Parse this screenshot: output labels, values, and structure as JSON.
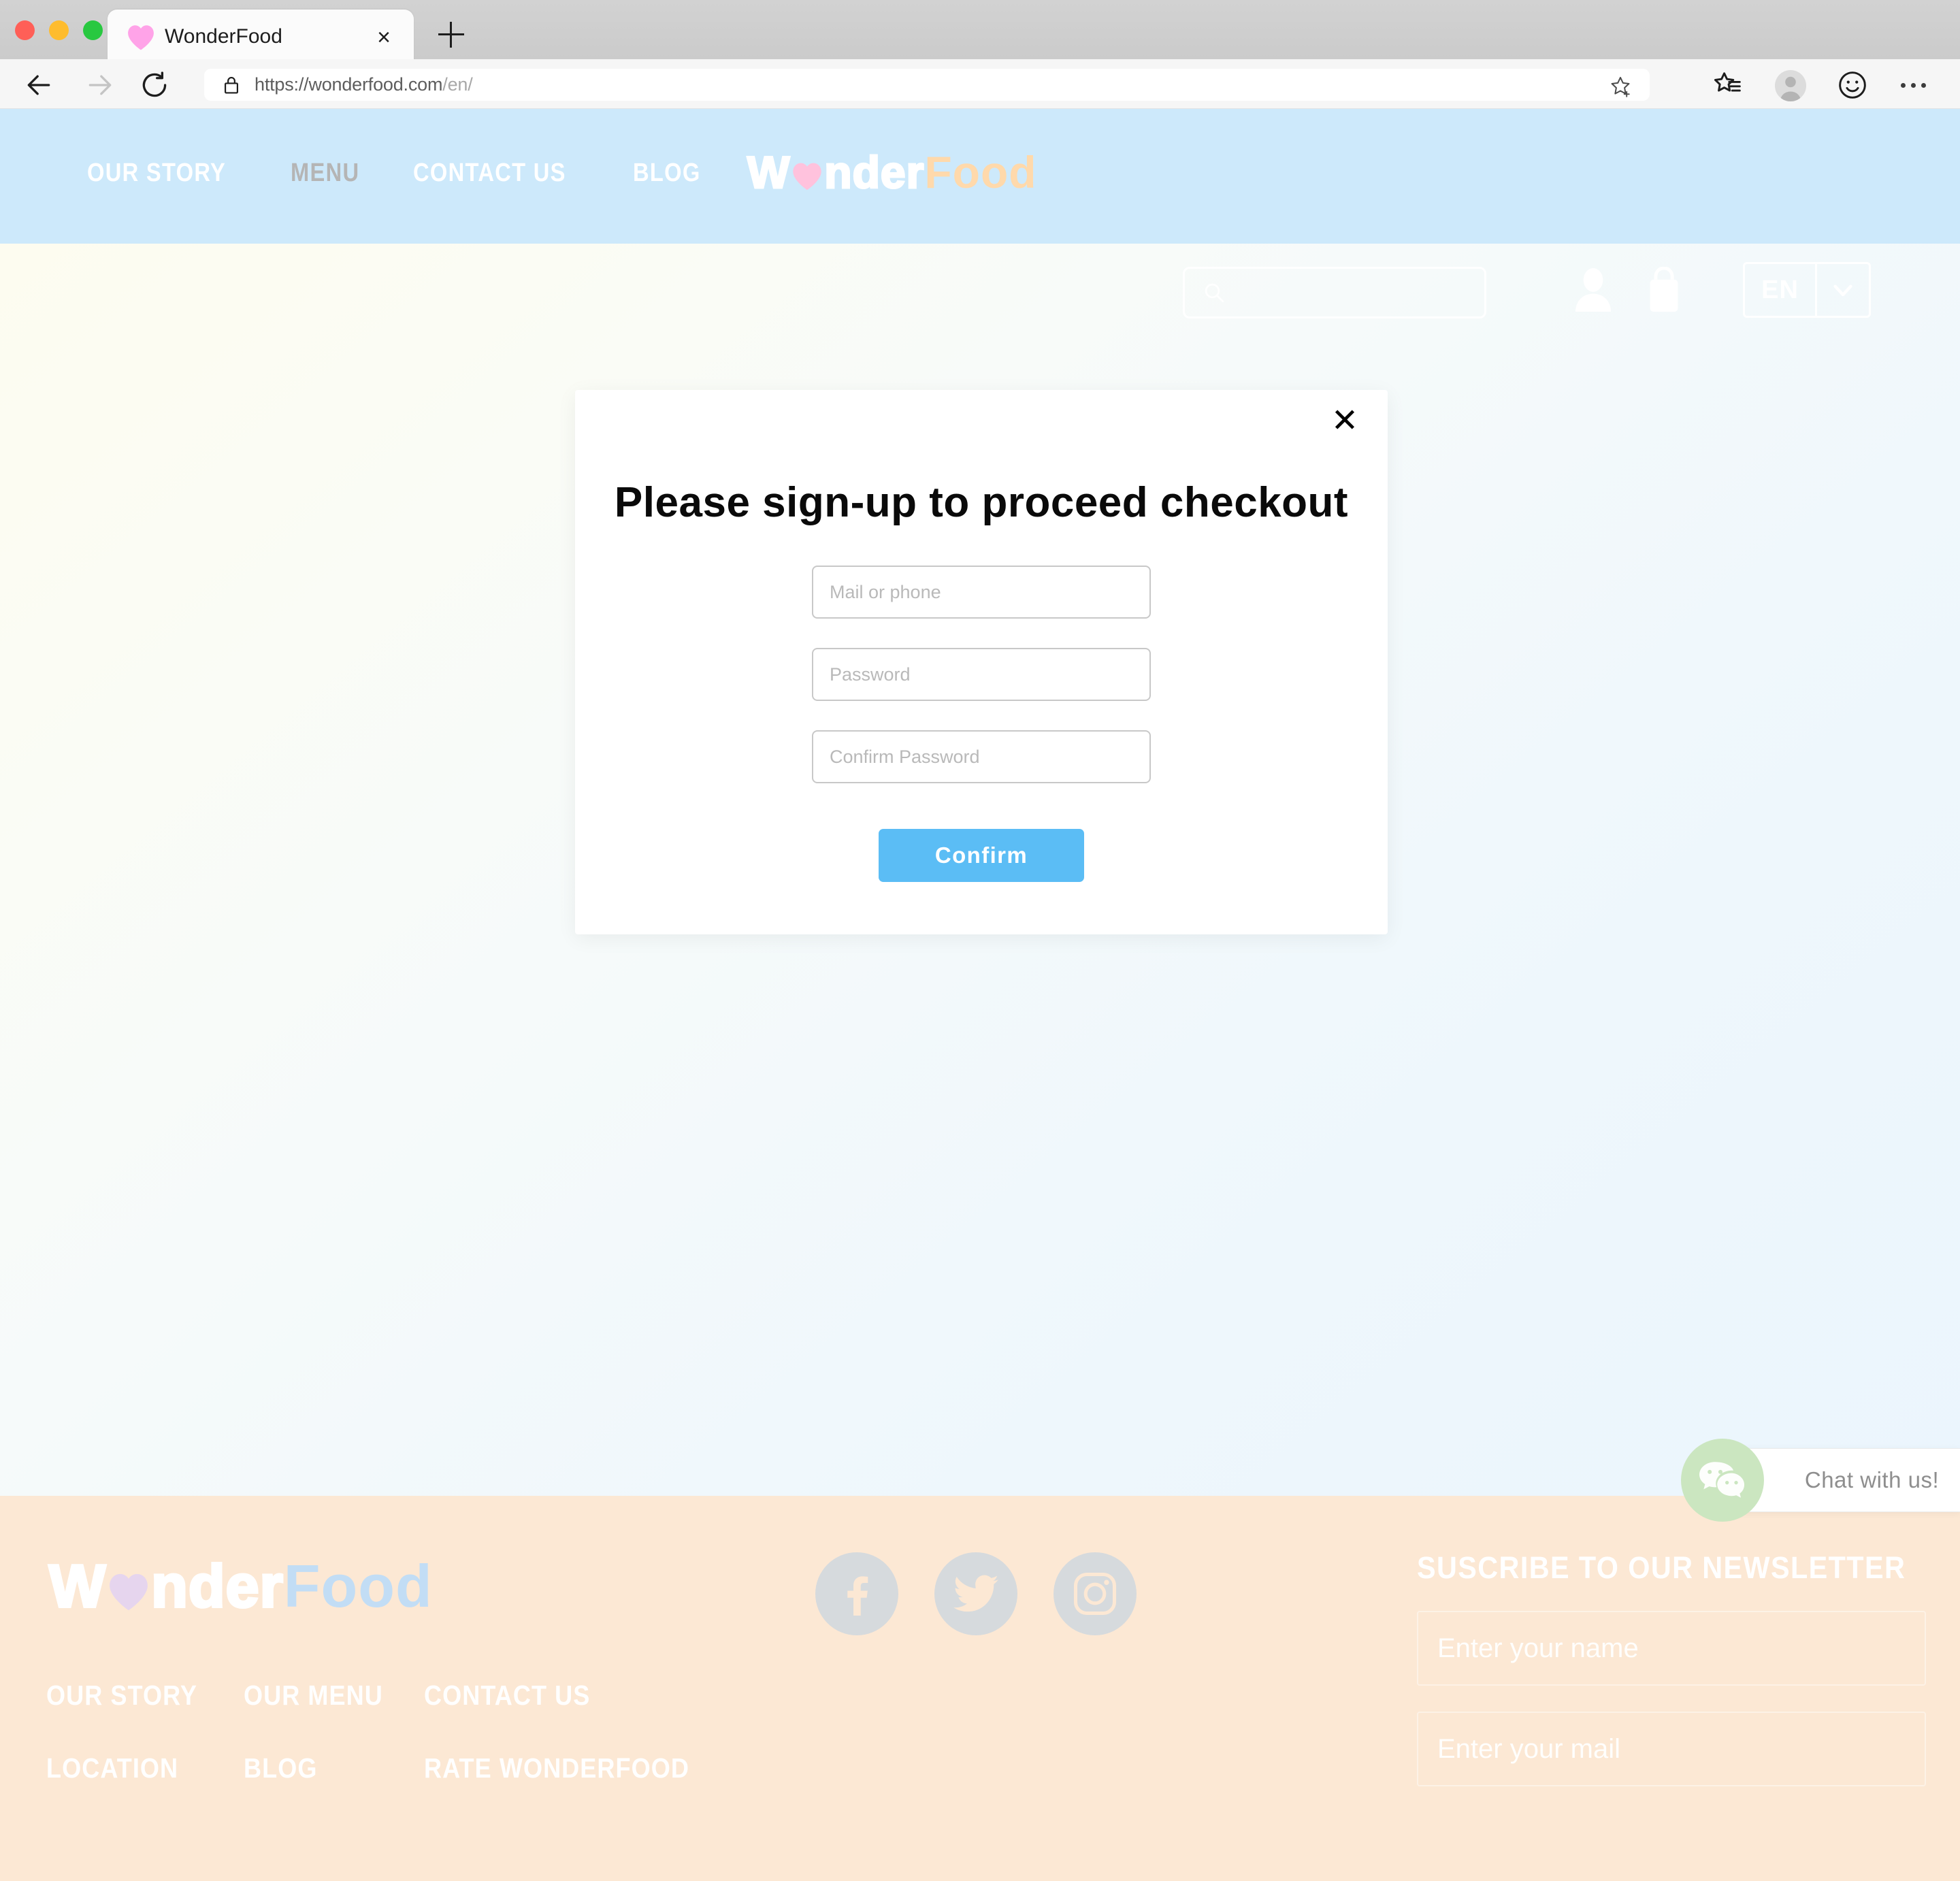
{
  "browser": {
    "tab": {
      "title": "WonderFood",
      "favicon": "heart-icon",
      "close_label": "×"
    },
    "new_tab_label": "+",
    "toolbar": {
      "back": "back-arrow-icon",
      "forward": "forward-arrow-icon",
      "reload": "reload-icon",
      "lock": "lock-icon",
      "url_host": "https://wonderfood.com",
      "url_path": "/en/",
      "star": "add-favorite-star-icon",
      "collections": "collections-star-icon",
      "profile": "profile-avatar-icon",
      "smiley": "feedback-smiley-icon",
      "more": "more-options-icon"
    },
    "window_controls": [
      "close",
      "minimize",
      "maximize"
    ]
  },
  "header": {
    "nav": [
      {
        "label": "OUR STORY",
        "active": false
      },
      {
        "label": "MENU",
        "active": true
      },
      {
        "label": "CONTACT US",
        "active": false
      },
      {
        "label": "BLOG",
        "active": false
      }
    ],
    "brand": {
      "part_outline_1": "W",
      "heart": "heart-icon",
      "part_outline_2": "nder",
      "part_solid": "Food",
      "solid_color": "#ffd9ab",
      "heart_color": "#ffc2dd"
    },
    "search": {
      "value": "",
      "placeholder": "",
      "icon": "search-icon"
    },
    "icons": {
      "account": "user-icon",
      "cart": "shopping-bag-icon"
    },
    "language": {
      "code": "EN",
      "caret": "chevron-down-icon"
    },
    "background_color": "#cde9fb"
  },
  "modal": {
    "title": "Please sign-up to proceed checkout",
    "close_label": "✕",
    "fields": [
      {
        "name": "mail-or-phone",
        "type": "text",
        "value": "",
        "placeholder": "Mail or phone"
      },
      {
        "name": "password",
        "type": "password",
        "value": "",
        "placeholder": "Password"
      },
      {
        "name": "confirm-password",
        "type": "password",
        "value": "",
        "placeholder": "Confirm Password"
      }
    ],
    "submit_label": "Confirm",
    "submit_color": "#5bbdf5"
  },
  "chat": {
    "label": "Chat with us!",
    "icon": "wechat-bubbles-icon",
    "circle_color": "#cbe6c0"
  },
  "footer": {
    "background_color": "#fce8d4",
    "brand": {
      "part_outline_1": "W",
      "heart": "heart-icon",
      "part_outline_2": "nder",
      "part_solid": "Food",
      "solid_color": "#c2ddf5",
      "heart_color": "#e6d5ee"
    },
    "links": [
      "OUR STORY",
      "OUR MENU",
      "CONTACT US",
      "LOCATION",
      "BLOG",
      "RATE WONDERFOOD"
    ],
    "socials": [
      {
        "name": "facebook",
        "icon": "facebook-icon"
      },
      {
        "name": "twitter",
        "icon": "twitter-icon"
      },
      {
        "name": "instagram",
        "icon": "instagram-icon"
      }
    ],
    "newsletter": {
      "title": "SUSCRIBE TO OUR NEWSLETTER",
      "name_input": {
        "value": "",
        "placeholder": "Enter your name"
      },
      "mail_input": {
        "value": "",
        "placeholder": "Enter your mail"
      }
    }
  }
}
